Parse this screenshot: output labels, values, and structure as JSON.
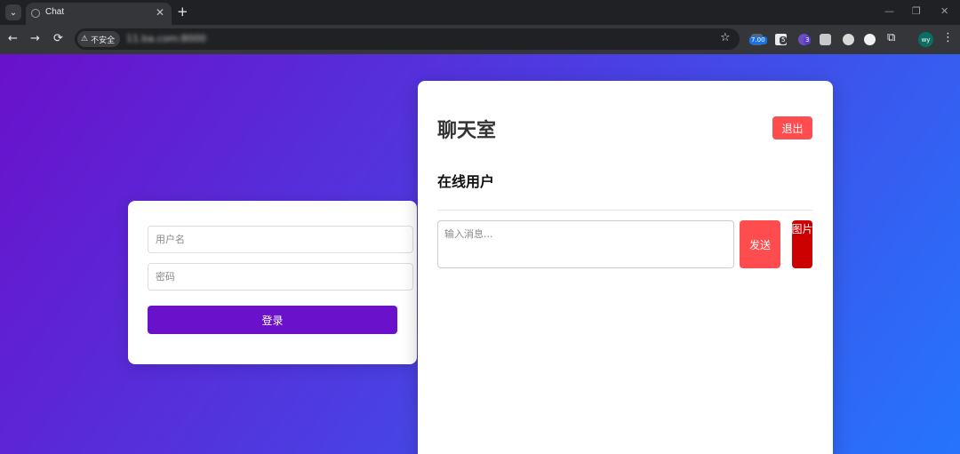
{
  "browser": {
    "tab_title": "Chat",
    "security_label": "不安全",
    "url": "11.ba.com:8000",
    "extension_badges": [
      "7.00",
      "5",
      "3"
    ],
    "profile_initials": "wy"
  },
  "login": {
    "username_placeholder": "用户名",
    "password_placeholder": "密码",
    "login_label": "登录"
  },
  "chat": {
    "title": "聊天室",
    "logout_label": "退出",
    "online_heading": "在线用户",
    "message_placeholder": "输入消息...",
    "send_label": "发送",
    "image_label": "图片"
  },
  "colors": {
    "gradient_start": "#6a11cb",
    "gradient_end": "#2575fc",
    "login_button": "#6a11cb",
    "logout_button": "#ff4d4f",
    "send_button": "#ff4d4f",
    "image_button": "#cc0000"
  }
}
